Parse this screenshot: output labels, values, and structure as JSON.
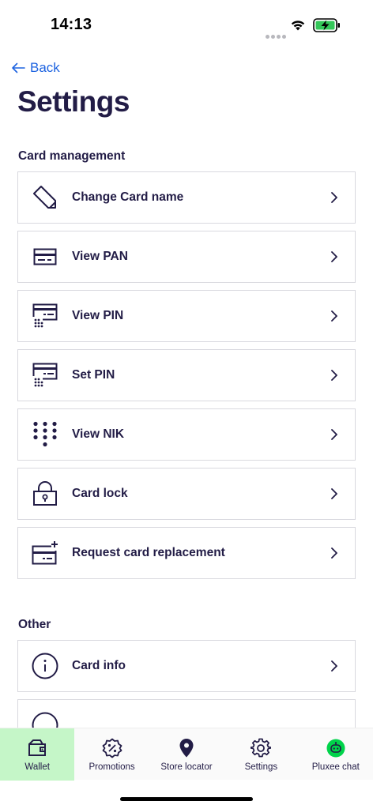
{
  "status_bar": {
    "time": "14:13"
  },
  "nav": {
    "back_label": "Back"
  },
  "page": {
    "title": "Settings"
  },
  "sections": {
    "card_management": {
      "title": "Card management",
      "items": [
        {
          "label": "Change Card name",
          "icon": "pencil-icon"
        },
        {
          "label": "View PAN",
          "icon": "card-icon"
        },
        {
          "label": "View PIN",
          "icon": "card-pin-icon"
        },
        {
          "label": "Set PIN",
          "icon": "card-pin-icon"
        },
        {
          "label": "View NIK",
          "icon": "keypad-icon"
        },
        {
          "label": "Card lock",
          "icon": "lock-icon"
        },
        {
          "label": "Request card replacement",
          "icon": "card-plus-icon"
        }
      ]
    },
    "other": {
      "title": "Other",
      "items": [
        {
          "label": "Card info",
          "icon": "info-icon"
        }
      ]
    }
  },
  "bottom_nav": {
    "items": [
      {
        "label": "Wallet",
        "icon": "wallet-icon",
        "active": true
      },
      {
        "label": "Promotions",
        "icon": "percent-badge-icon"
      },
      {
        "label": "Store locator",
        "icon": "location-pin-icon"
      },
      {
        "label": "Settings",
        "icon": "gear-icon"
      },
      {
        "label": "Pluxee chat",
        "icon": "chat-bot-icon"
      }
    ]
  },
  "colors": {
    "primary_text": "#221c46",
    "link": "#1d63e0",
    "active_nav_bg": "#c5f6c8",
    "border": "#d9d9df",
    "battery": "#34c759"
  }
}
